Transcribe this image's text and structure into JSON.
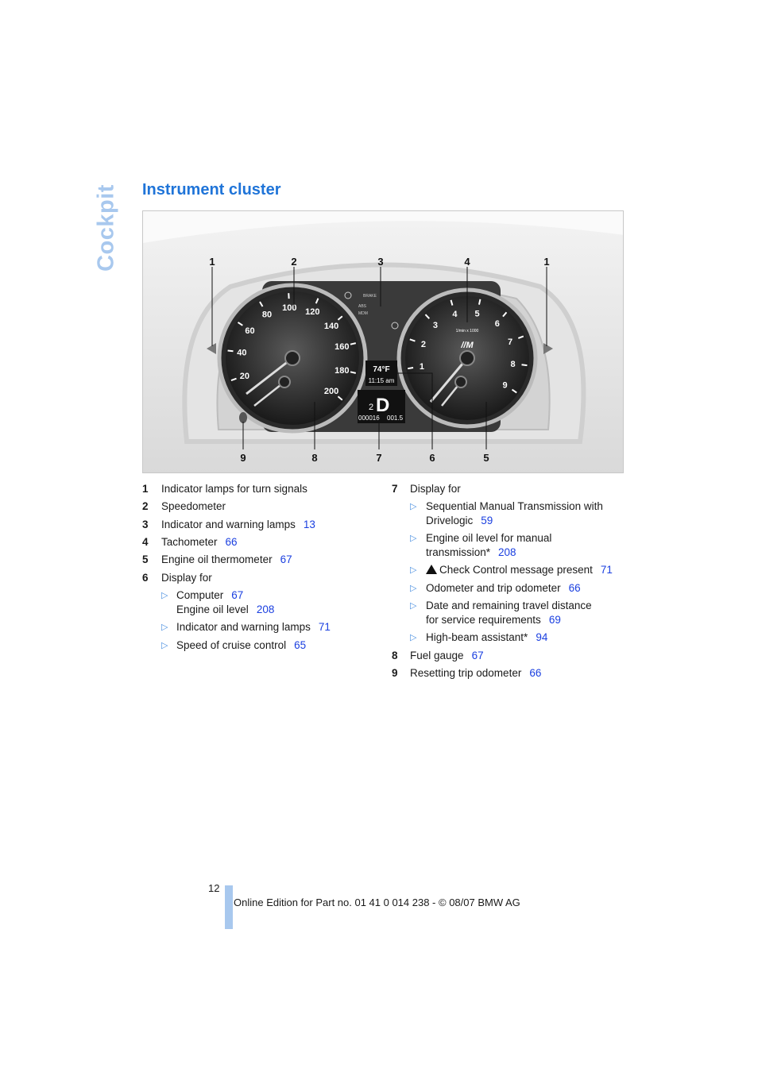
{
  "side_tab": "Cockpit",
  "title": "Instrument cluster",
  "figure": {
    "callouts_top": [
      "1",
      "2",
      "3",
      "4",
      "1"
    ],
    "callouts_bottom": [
      "9",
      "8",
      "7",
      "6",
      "5"
    ],
    "speedo_labels": [
      "20",
      "40",
      "60",
      "80",
      "100",
      "120",
      "140",
      "160",
      "180",
      "200"
    ],
    "tacho_labels": [
      "1",
      "2",
      "3",
      "4",
      "5",
      "6",
      "7",
      "8",
      "9"
    ],
    "tacho_unit": "1/min x 1000",
    "temperature": "74°F",
    "clock": "11:15 am",
    "gear": "D",
    "gear_number": "2",
    "odometer": "000016",
    "trip": "001.5",
    "warning_labels": [
      "BRAKE",
      "ABS",
      "MDM"
    ]
  },
  "left_list": [
    {
      "num": "1",
      "text": "Indicator lamps for turn signals",
      "ref": ""
    },
    {
      "num": "2",
      "text": "Speedometer",
      "ref": ""
    },
    {
      "num": "3",
      "text": "Indicator and warning lamps",
      "ref": "13"
    },
    {
      "num": "4",
      "text": "Tachometer",
      "ref": "66"
    },
    {
      "num": "5",
      "text": "Engine oil thermometer",
      "ref": "67"
    },
    {
      "num": "6",
      "text": "Display for",
      "ref": ""
    }
  ],
  "left_sub": [
    {
      "text": "Computer",
      "ref": "67"
    },
    {
      "text": "Engine oil level",
      "ref": "208"
    },
    {
      "text": "Indicator and warning lamps",
      "ref": "71"
    },
    {
      "text": "Speed of cruise control",
      "ref": "65"
    }
  ],
  "right_list": {
    "item7": {
      "num": "7",
      "text": "Display for"
    },
    "sub": [
      {
        "line1": "Sequential Manual Transmission with",
        "line2": "Drivelogic",
        "ref": "59"
      },
      {
        "line1": "Engine oil level for manual",
        "line2": "transmission*",
        "ref": "208"
      },
      {
        "line1": "Check Control message present",
        "ref": "71"
      },
      {
        "line1": "Odometer and trip odometer",
        "ref": "66"
      },
      {
        "line1": "Date and remaining travel distance",
        "line2": "for service requirements",
        "ref": "69"
      },
      {
        "line1": "High-beam assistant*",
        "ref": "94"
      }
    ],
    "item8": {
      "num": "8",
      "text": "Fuel gauge",
      "ref": "67"
    },
    "item9": {
      "num": "9",
      "text": "Resetting trip odometer",
      "ref": "66"
    }
  },
  "page_number": "12",
  "footer": "Online Edition for Part no. 01 41 0 014 238 - © 08/07 BMW AG"
}
